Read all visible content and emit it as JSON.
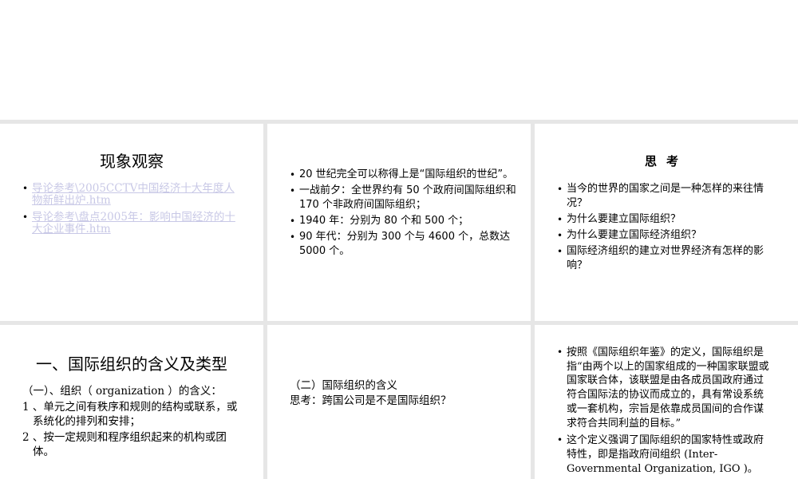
{
  "slide1": {
    "title": "现象观察",
    "links": [
      "导论参考\\2005CCTV中国经济十大年度人物新鲜出炉.htm",
      "导论参考\\盘点2005年：影响中国经济的十大企业事件.htm"
    ]
  },
  "slide2": {
    "bullets": [
      "20 世纪完全可以称得上是“国际组织的世纪”。",
      "一战前夕：全世界约有 50 个政府间国际组织和 170 个非政府间国际组织；",
      "1940 年：分别为 80 个和 500 个；",
      "90 年代：分别为 300 个与 4600 个，总数达 5000 个。"
    ]
  },
  "slide3": {
    "title": "思考",
    "bullets": [
      "当今的世界的国家之间是一种怎样的来往情况？",
      "为什么要建立国际组织？",
      "为什么要建立国际经济组织？",
      "国际经济组织的建立对世界经济有怎样的影响？"
    ]
  },
  "slide4": {
    "title": "一、国际组织的含义及类型",
    "intro": "（一）、组织（ organization ）的含义：",
    "items": [
      "1 、单元之间有秩序和规则的结构或联系，或系统化的排列和安排；",
      "2 、按一定规则和程序组织起来的机构或团体。"
    ]
  },
  "slide5": {
    "line1": "（二）国际组织的含义",
    "line2": "思考：跨国公司是不是国际组织？"
  },
  "slide6": {
    "bullets": [
      "按照《国际组织年鉴》的定义，国际组织是指“由两个以上的国家组成的一种国家联盟或国家联合体，该联盟是由各成员国政府通过符合国际法的协议而成立的，具有常设系统或一套机构，宗旨是依靠成员国间的合作谋求符合共同利益的目标。”",
      "这个定义强调了国际组织的国家特性或政府特性，即是指政府间组织 (Inter-Governmental Organization, IGO )。"
    ]
  },
  "icons": {
    "bullet": "•"
  }
}
